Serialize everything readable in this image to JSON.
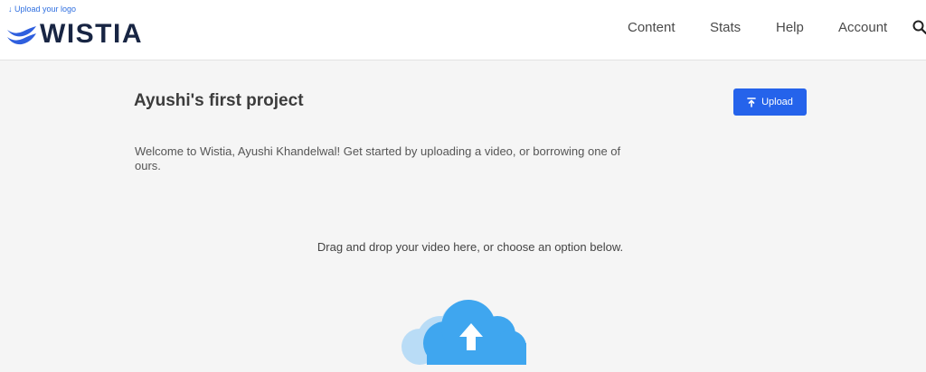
{
  "header": {
    "upload_logo_label": "↓ Upload your logo",
    "brand_name": "WISTIA",
    "nav": [
      {
        "label": "Content"
      },
      {
        "label": "Stats"
      },
      {
        "label": "Help"
      },
      {
        "label": "Account"
      }
    ],
    "search_icon": "search-icon"
  },
  "project": {
    "title": "Ayushi's first project",
    "upload_button_label": "Upload",
    "welcome_text": "Welcome to Wistia, Ayushi Khandelwal! Get started by uploading a video, or borrowing one of ours.",
    "drag_text": "Drag and drop your video here, or choose an option below."
  },
  "colors": {
    "accent": "#2563eb",
    "brand_navy": "#182543",
    "brand_blue": "#2f5fde",
    "cloud_front": "#3fa6ef",
    "cloud_back": "#b9dcf6"
  },
  "icons": [
    "wistia-logo-icon",
    "upload-arrow-icon",
    "search-icon",
    "cloud-upload-icon"
  ]
}
